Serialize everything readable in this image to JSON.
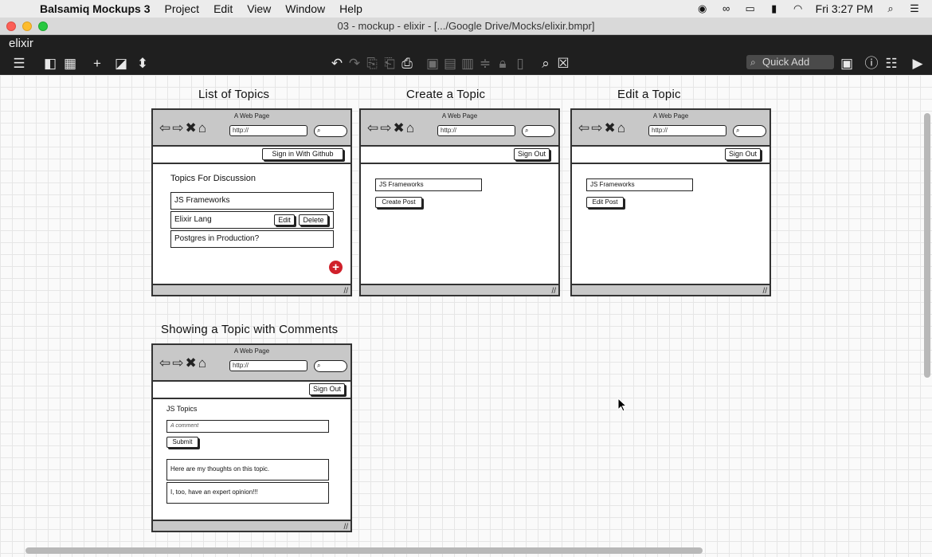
{
  "menubar": {
    "app_name": "Balsamiq Mockups 3",
    "items": [
      "Project",
      "Edit",
      "View",
      "Window",
      "Help"
    ],
    "clock": "Fri 3:27 PM"
  },
  "window": {
    "title": "03 - mockup - elixir - [.../Google Drive/Mocks/elixir.bmpr]",
    "project_name": "elixir",
    "quick_add_label": "Quick Add"
  },
  "mockups": {
    "list": {
      "title": "List of Topics",
      "page_label": "A Web Page",
      "url": "http://",
      "signin_label": "Sign in With Github",
      "heading": "Topics For Discussion",
      "topics": [
        "JS Frameworks",
        "Elixir Lang",
        "Postgres in Production?"
      ],
      "edit_label": "Edit",
      "delete_label": "Delete",
      "add_label": "+"
    },
    "create": {
      "title": "Create a Topic",
      "page_label": "A Web Page",
      "url": "http://",
      "signout_label": "Sign Out",
      "input_value": "JS Frameworks",
      "submit_label": "Create Post"
    },
    "edit": {
      "title": "Edit a Topic",
      "page_label": "A Web Page",
      "url": "http://",
      "signout_label": "Sign Out",
      "input_value": "JS Frameworks",
      "submit_label": "Edit Post"
    },
    "show": {
      "title": "Showing a Topic with Comments",
      "page_label": "A Web Page",
      "url": "http://",
      "signout_label": "Sign Out",
      "topic_label": "JS Topics",
      "comment_placeholder": "A comment",
      "submit_label": "Submit",
      "comments": [
        "Here are my thoughts on this topic.",
        "I, too, have an expert opinion!!!"
      ]
    }
  }
}
